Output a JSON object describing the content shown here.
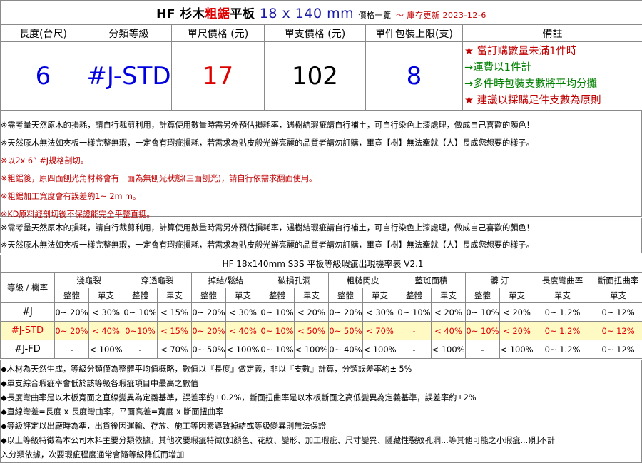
{
  "title": {
    "prefix": "HF 杉木",
    "highlight": "粗鋸",
    "suffix": "平板",
    "size": "18 x 140 mm",
    "list": "價格一覽",
    "updated": "～ 庫存更新 2023-12-6"
  },
  "headers": [
    "長度(台尺)",
    "分類等級",
    "單尺價格 (元)",
    "單支價格 (元)",
    "單件包裝上限(支)",
    "備註"
  ],
  "values": {
    "length": "6",
    "grade": "#J-STD",
    "price_per_foot": "17",
    "price_per_piece": "102",
    "pack_limit": "8"
  },
  "remarks": [
    "★ 當訂購數量未滿1件時",
    "→運費以1件計",
    "→多件時包裝支數將平均分攤",
    "★ 建議以採購足件支數為原則"
  ],
  "notice1": [
    "※需考量天然原木的損耗，請自行裁剪利用，計算使用數量時需另外預估損耗率，遇樹結瑕疵請自行補土，可自行染色上漆處理，做成自己喜歡的顏色！",
    "※天然原木無法如夾板一樣完整無瑕，一定會有瑕疵損耗，若需求為貼皮般光鮮亮麗的品質者請勿訂購，畢竟【樹】無法牽就【人】長成您想要的樣子。",
    "※以2x 6” #J規格剖切。",
    "※粗鋸後，原四面刨光角材將會有一面為無刨光狀態(三面刨光)，請自行依需求翻面使用。",
    "※粗鋸加工寬度會有誤差約1~ 2m m。",
    "※KD原料經剖切後不保證能完全平整直挺。"
  ],
  "notice2": [
    "※需考量天然原木的損耗，請自行裁剪利用，計算使用數量時需另外預估損耗率，遇樹結瑕疵請自行補土，可自行染色上漆處理，做成自己喜歡的顏色！",
    "※天然原木無法如夾板一樣完整無瑕，一定會有瑕疵損耗，若需求為貼皮般光鮮亮麗的品質者請勿訂購，畢竟【樹】無法牽就【人】長成您想要的樣子。"
  ],
  "defect_table": {
    "title": "HF 18x140mm S3S 平板等級瑕疵出現機率表 V2.1",
    "grade_header": "等級 / 機率",
    "groups": [
      "淺龜裂",
      "穿透龜裂",
      "掉結/鬆結",
      "破損孔洞",
      "粗糙閃皮",
      "藍斑面積",
      "髒 汙",
      "長度彎曲率",
      "斷面扭曲率"
    ],
    "sub_whole": "整體",
    "sub_single": "單支",
    "rows": [
      {
        "grade": "#J",
        "cells": [
          "0~ 20%",
          "< 30%",
          "0~ 10%",
          "< 15%",
          "0~ 20%",
          "< 30%",
          "0~ 10%",
          "< 20%",
          "0~ 20%",
          "< 30%",
          "0~ 10%",
          "< 20%",
          "0~ 10%",
          "< 20%",
          "0~ 1.2%",
          "0~ 12%"
        ]
      },
      {
        "grade": "#J-STD",
        "cells": [
          "0~ 20%",
          "< 40%",
          "0~10%",
          "< 15%",
          "0~ 20%",
          "< 40%",
          "0~ 10%",
          "< 50%",
          "0~ 50%",
          "< 70%",
          "-",
          "< 40%",
          "0~ 10%",
          "< 20%",
          "0~ 1.2%",
          "0~ 12%"
        ]
      },
      {
        "grade": "#J-FD",
        "cells": [
          "-",
          "< 100%",
          "-",
          "< 70%",
          "0~ 50%",
          "< 100%",
          "0~ 10%",
          "< 100%",
          "0~ 40%",
          "< 100%",
          "-",
          "< 100%",
          "-",
          "< 100%",
          "0~ 1.2%",
          "0~ 12%"
        ]
      }
    ]
  },
  "bottom_notes": [
    "◆木材為天然生成，等級分類僅為整體平均值概略，數值以『長度』做定義，非以『支數』計算，分類誤差率約± 5%",
    "◆單支綜合瑕疵率會低於該等級各瑕疵項目中最高之數值",
    "◆長度彎曲率是以木板寬面之直線變異為定義基準，誤差率約±0.2%，斷面扭曲率是以木板斷面之高低變異為定義基準，誤差率約±2%",
    "◆直線彎差=長度 x 長度彎曲率，平面高差=寬度 x 斷面扭曲率",
    "◆等級評定以出廠時為準，出貨後因運輸、存放、施工等因素導致掉結或等級變異則無法保證",
    "◆以上等級特徵為本公司木料主要分類依據，其他次要瑕疵特徵(如顏色、花紋、變形、加工瑕疵、尺寸變異、隱藏性裂紋孔洞...等其他可能之小瑕疵...)則不計",
    "入分類依據，次要瑕疵程度通常會隨等級降低而增加"
  ]
}
